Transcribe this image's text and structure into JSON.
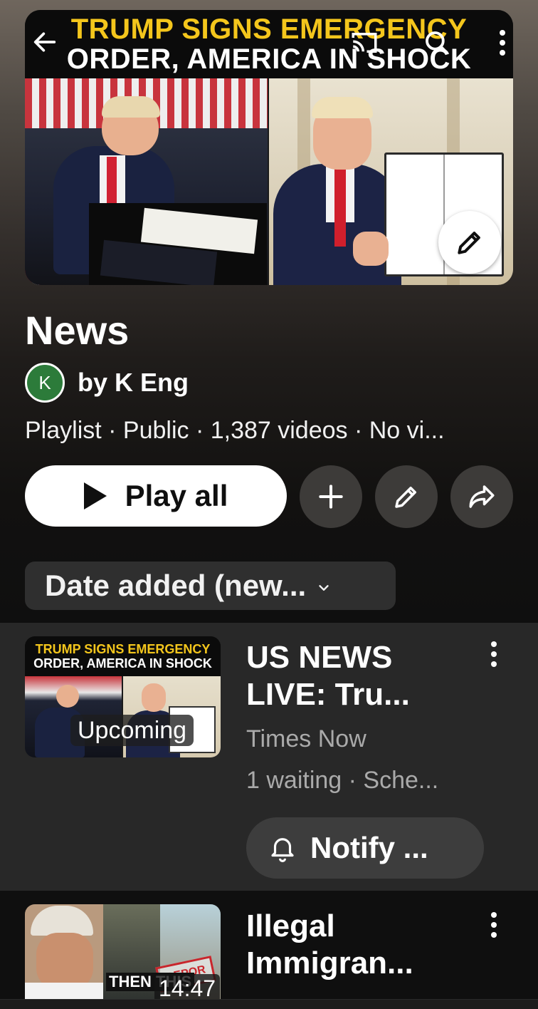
{
  "hero": {
    "banner_line1": "TRUMP SIGNS EMERGENCY",
    "banner_line2": "ORDER, AMERICA IN SHOCK"
  },
  "playlist": {
    "title": "News",
    "avatar_letter": "K",
    "owner": "by K Eng",
    "meta": "Playlist · Public · 1,387 videos · No vi..."
  },
  "actions": {
    "play_all": "Play all"
  },
  "sort": {
    "selected": "Date added (new..."
  },
  "videos": [
    {
      "thumb_line1": "TRUMP SIGNS EMERGENCY",
      "thumb_line2": "ORDER, AMERICA IN SHOCK",
      "badge": "Upcoming",
      "title": "US NEWS LIVE: Tru...",
      "channel": "Times Now",
      "stats": "1 waiting · Sche...",
      "notify_label": "Notify ..."
    },
    {
      "thumb_text": "THEN THIS",
      "stamp": "DEPOR",
      "duration": "14:47",
      "title": "Illegal Immigran..."
    }
  ],
  "colors": {
    "banner_yellow": "#f4c61c",
    "avatar_green": "#2c7b3a",
    "row_highlight": "#282828"
  },
  "icons": [
    "back-arrow-icon",
    "cast-icon",
    "search-icon",
    "more-vert-icon",
    "pencil-icon",
    "play-icon",
    "plus-icon",
    "share-icon",
    "chevron-down-icon",
    "bell-icon"
  ]
}
